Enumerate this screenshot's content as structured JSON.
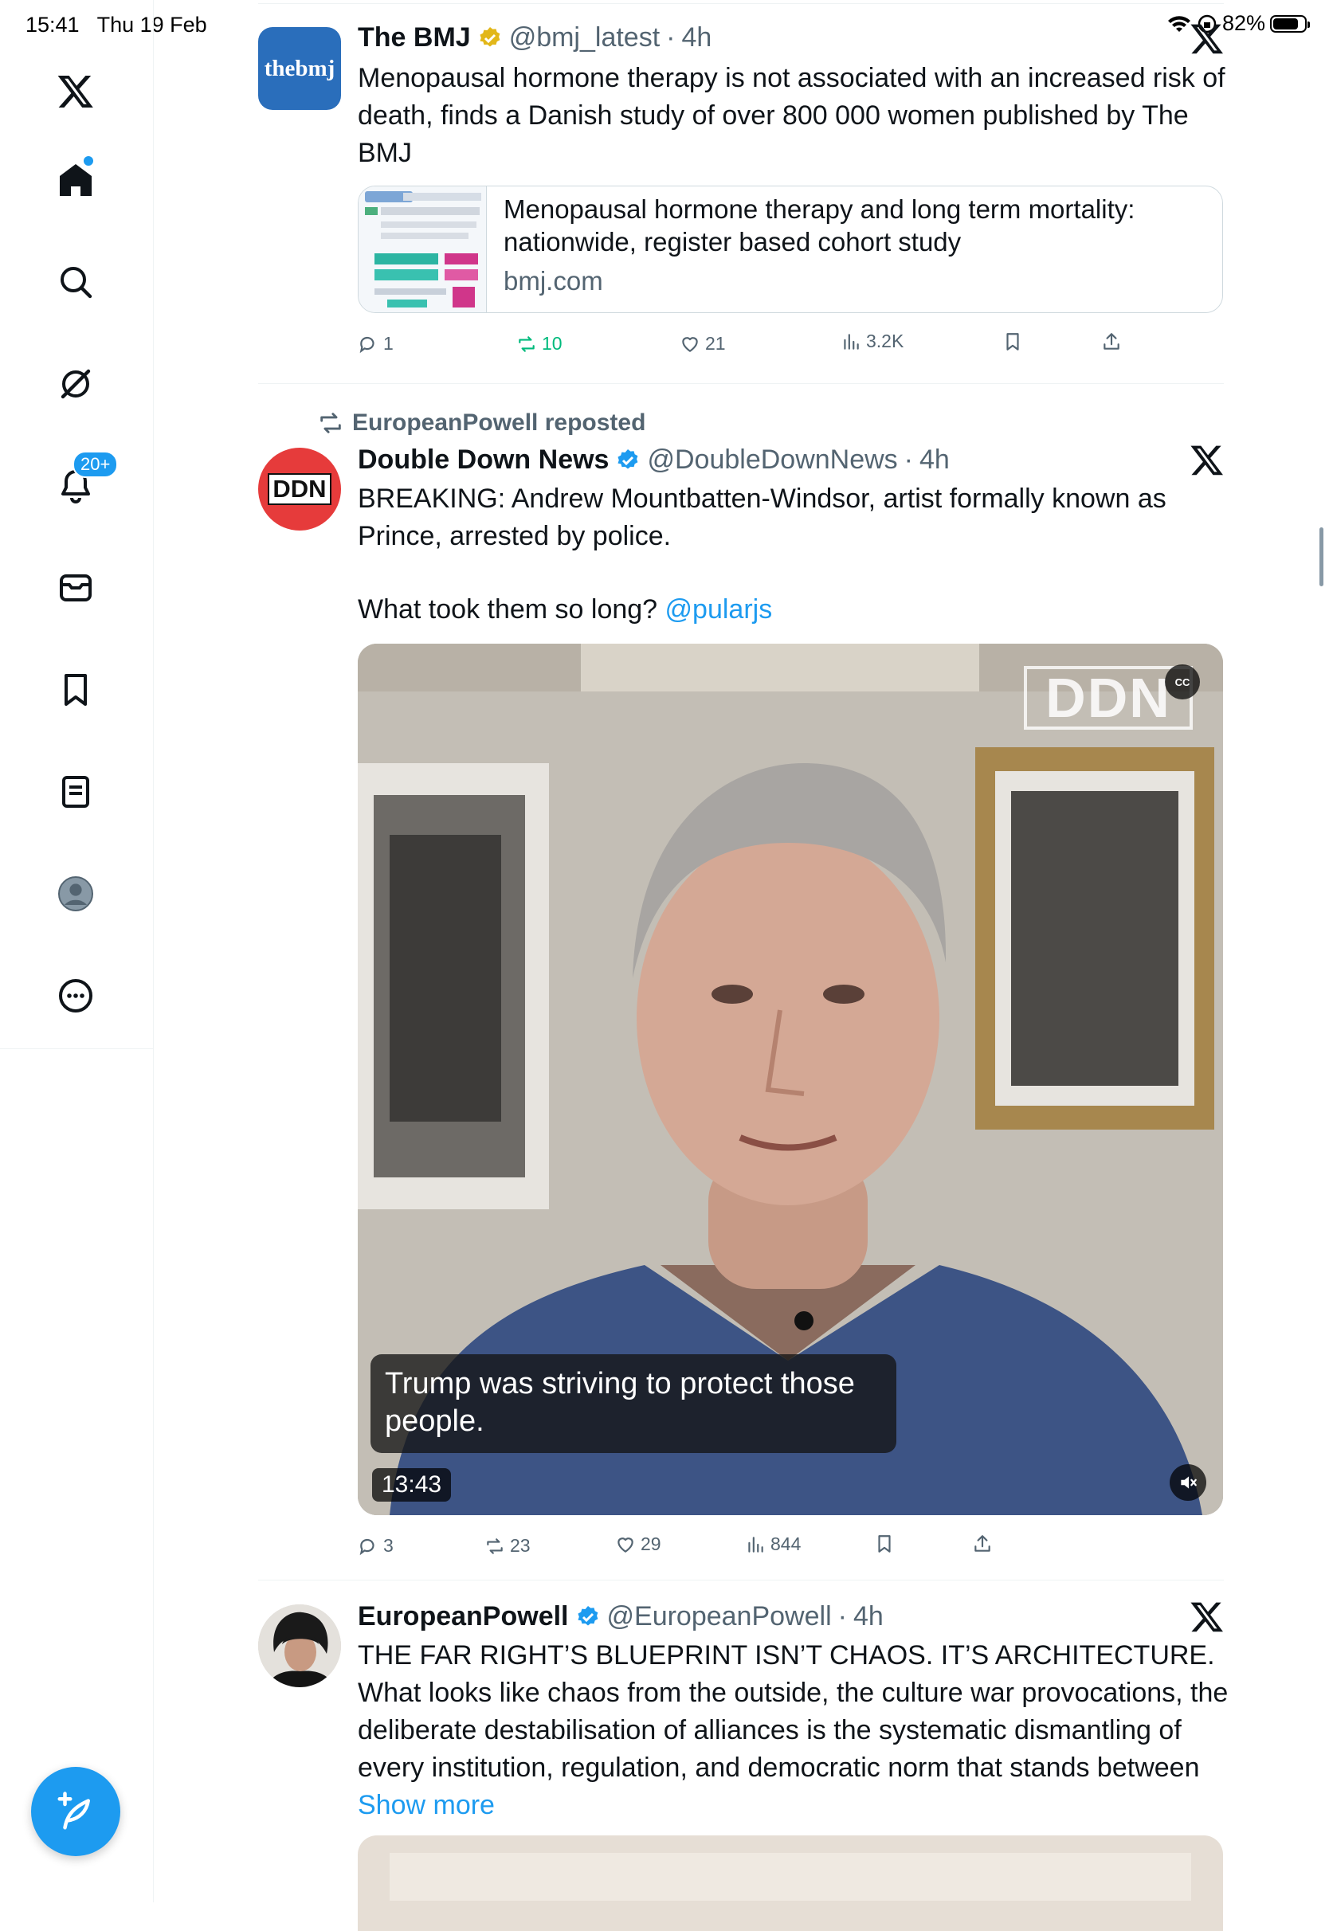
{
  "status": {
    "time": "15:41",
    "date": "Thu 19 Feb",
    "battery": "82%",
    "battery_level": 0.82
  },
  "sidebar": {
    "items": [
      {
        "name": "x-logo"
      },
      {
        "name": "home",
        "has_dot": true
      },
      {
        "name": "search"
      },
      {
        "name": "grok"
      },
      {
        "name": "notifications",
        "badge": "20+"
      },
      {
        "name": "messages"
      },
      {
        "name": "bookmarks"
      },
      {
        "name": "lists"
      },
      {
        "name": "profile"
      },
      {
        "name": "more"
      }
    ]
  },
  "tweets": [
    {
      "name": "The BMJ",
      "verified": "gold",
      "handle": "@bmj_latest",
      "time": "4h",
      "avatar_text": "thebmj",
      "text": "Menopausal hormone therapy is not associated with an increased risk of death, finds a Danish study of over 800 000 women published by The BMJ",
      "card": {
        "title": "Menopausal hormone therapy and long term mortality: nationwide, register based cohort study",
        "domain": "bmj.com"
      },
      "stats": {
        "replies": "1",
        "reposts": "10",
        "likes": "21",
        "views": "3.2K"
      }
    },
    {
      "repost_label": "EuropeanPowell reposted",
      "name": "Double Down News",
      "verified": "blue",
      "handle": "@DoubleDownNews",
      "time": "4h",
      "avatar_text": "DDN",
      "text_line1": "BREAKING: Andrew Mountbatten-Windsor, artist formally known as Prince, arrested by police.",
      "text_line2": "What took them so long?",
      "mention": "@pularjs",
      "video": {
        "watermark": "DDN",
        "cc": "CC",
        "caption": "Trump was striving to protect those people.",
        "duration": "13:43"
      },
      "stats": {
        "replies": "3",
        "reposts": "23",
        "likes": "29",
        "views": "844"
      }
    },
    {
      "name": "EuropeanPowell",
      "verified": "blue",
      "handle": "@EuropeanPowell",
      "time": "4h",
      "text": "THE FAR RIGHT’S BLUEPRINT ISN’T CHAOS. IT’S ARCHITECTURE. What looks like chaos from the outside, the culture war provocations, the deliberate destabilisation of alliances is the systematic dismantling of every institution, regulation, and democratic norm that stands between",
      "show_more": "Show more"
    }
  ],
  "colors": {
    "accent": "#1d9bf0",
    "repost_green": "#00ba7c",
    "text": "#0f1419",
    "muted": "#536471",
    "bmj_blue": "#2a6ebb",
    "ddn_red": "#e63b3b"
  }
}
